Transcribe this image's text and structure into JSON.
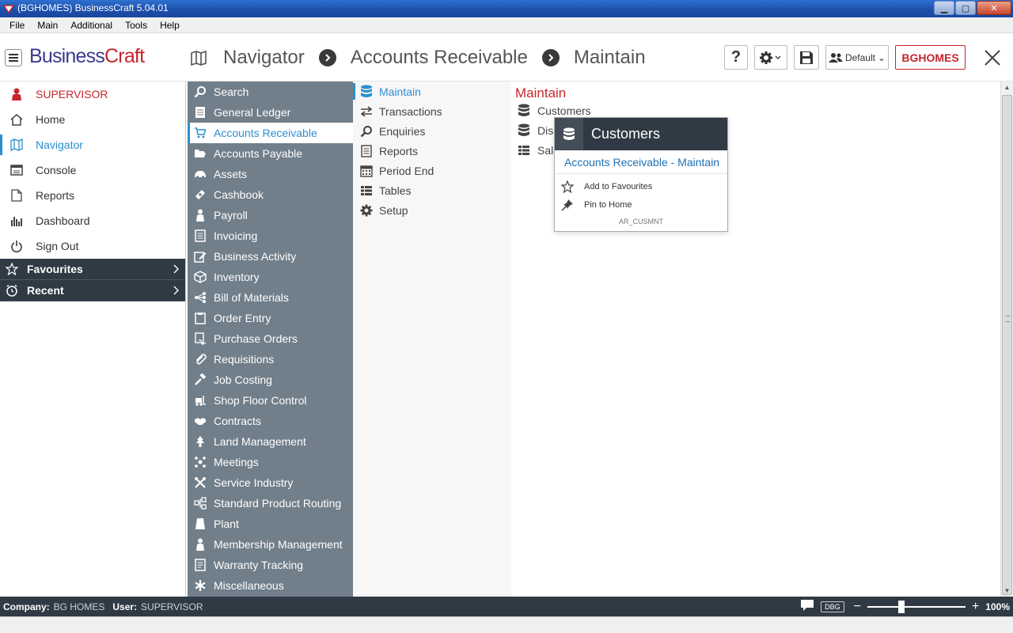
{
  "window": {
    "title": "(BGHOMES) BusinessCraft  5.04.01",
    "controls": [
      "minimize-icon",
      "maximize-icon",
      "close-icon"
    ]
  },
  "menubar": {
    "items": [
      "File",
      "Main",
      "Additional",
      "Tools",
      "Help"
    ]
  },
  "header": {
    "logo_part1": "Business",
    "logo_part2": "Craft",
    "breadcrumb": [
      "Navigator",
      "Accounts Receivable",
      "Maintain"
    ],
    "help_label": "?",
    "profile_label": "Default",
    "company_button": "BGHOMES"
  },
  "leftnav": {
    "items": [
      {
        "label": "SUPERVISOR",
        "icon": "user-icon"
      },
      {
        "label": "Home",
        "icon": "home-icon"
      },
      {
        "label": "Navigator",
        "icon": "map-icon"
      },
      {
        "label": "Console",
        "icon": "console-icon"
      },
      {
        "label": "Reports",
        "icon": "report-icon"
      },
      {
        "label": "Dashboard",
        "icon": "bar-chart-icon"
      },
      {
        "label": "Sign Out",
        "icon": "power-icon"
      }
    ],
    "groups": [
      {
        "label": "Favourites",
        "icon": "star-icon"
      },
      {
        "label": "Recent",
        "icon": "clock-icon"
      }
    ]
  },
  "modules": {
    "items": [
      "Search",
      "General Ledger",
      "Accounts Receivable",
      "Accounts Payable",
      "Assets",
      "Cashbook",
      "Payroll",
      "Invoicing",
      "Business Activity",
      "Inventory",
      "Bill of Materials",
      "Order Entry",
      "Purchase Orders",
      "Requisitions",
      "Job Costing",
      "Shop Floor Control",
      "Contracts",
      "Land Management",
      "Meetings",
      "Service Industry",
      "Standard Product Routing",
      "Plant",
      "Membership Management",
      "Warranty Tracking",
      "Miscellaneous"
    ],
    "active": "Accounts Receivable"
  },
  "submenu": {
    "items": [
      "Maintain",
      "Transactions",
      "Enquiries",
      "Reports",
      "Period End",
      "Tables",
      "Setup"
    ],
    "active": "Maintain"
  },
  "content": {
    "title": "Maintain",
    "items": [
      "Customers",
      "Disc",
      "Sale"
    ]
  },
  "popup": {
    "title": "Customers",
    "subtitle": "Accounts Receivable - Maintain",
    "actions": [
      "Add to Favourites",
      "Pin to Home"
    ],
    "code": "AR_CUSMNT"
  },
  "statusbar": {
    "company_label": "Company:",
    "company_value": "BG HOMES",
    "user_label": "User:",
    "user_value": "SUPERVISOR",
    "dbg_label": "DBG",
    "zoom_minus": "−",
    "zoom_plus": "+",
    "zoom_level": "100%"
  },
  "colors": {
    "accent": "#2b8fcf",
    "brand_red": "#c4262e",
    "brand_blue": "#3a3a8c",
    "dark": "#303a44",
    "modules_bg": "#717f8a"
  }
}
